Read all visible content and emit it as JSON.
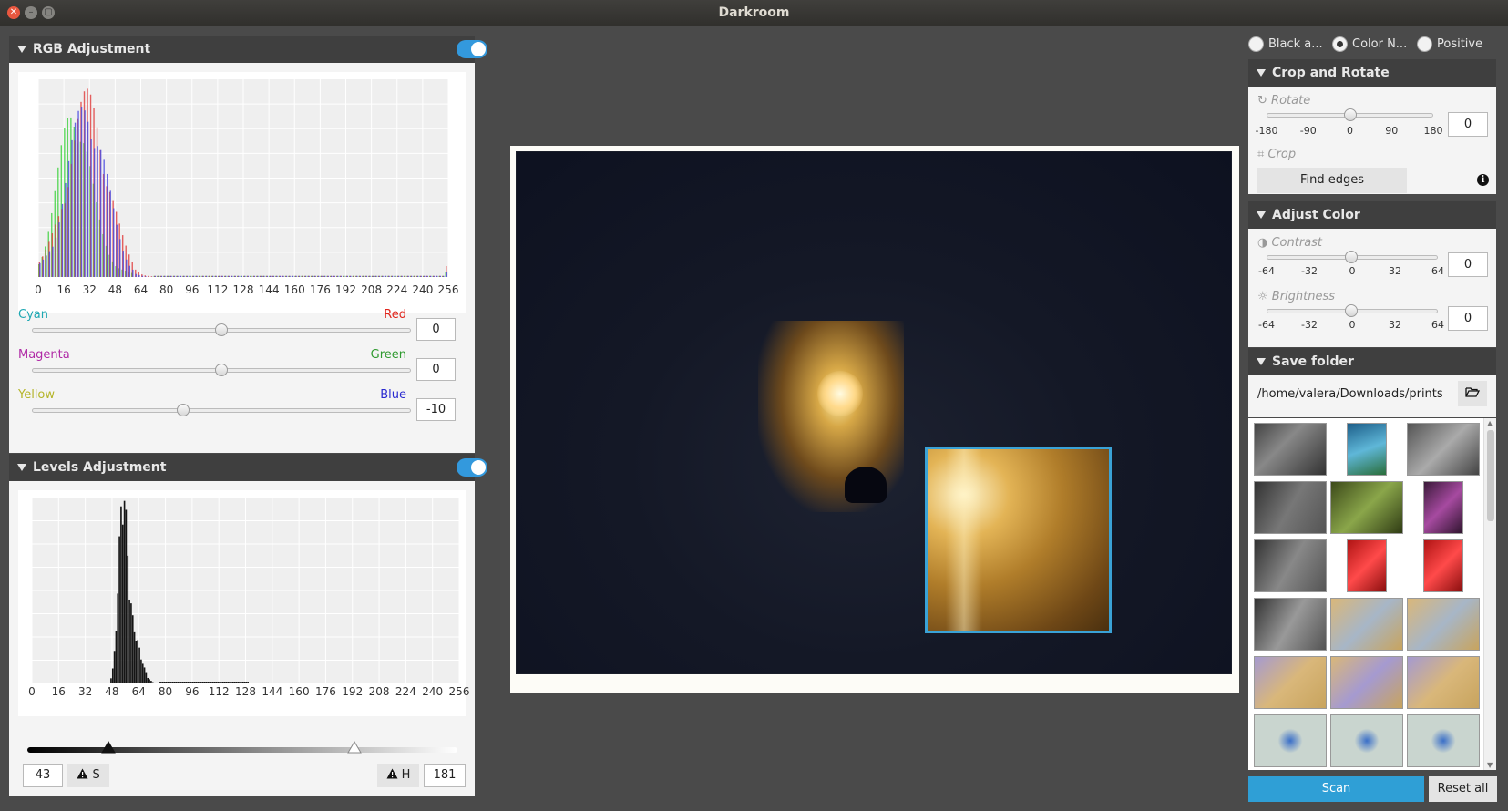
{
  "window": {
    "title": "Darkroom"
  },
  "rgb": {
    "title": "RGB Adjustment",
    "enabled": true,
    "histogram_ticks": [
      "0",
      "16",
      "32",
      "48",
      "64",
      "80",
      "96",
      "112",
      "128",
      "144",
      "160",
      "176",
      "192",
      "208",
      "224",
      "240",
      "256"
    ],
    "channels": [
      {
        "left": "Cyan",
        "right": "Red",
        "value": "0",
        "left_color": "#1fa8b3",
        "right_color": "#e0261d",
        "position": 0.5
      },
      {
        "left": "Magenta",
        "right": "Green",
        "value": "0",
        "left_color": "#b02aa6",
        "right_color": "#2f9a2f",
        "position": 0.5
      },
      {
        "left": "Yellow",
        "right": "Blue",
        "value": "-10",
        "left_color": "#b5b52a",
        "right_color": "#2a2ad0",
        "position": 0.4
      }
    ]
  },
  "levels": {
    "title": "Levels Adjustment",
    "enabled": true,
    "histogram_ticks": [
      "0",
      "16",
      "32",
      "48",
      "64",
      "80",
      "96",
      "112",
      "128",
      "144",
      "160",
      "176",
      "192",
      "208",
      "224",
      "240",
      "256"
    ],
    "shadow_value": "43",
    "highlight_value": "181",
    "shadow_button": "S",
    "highlight_button": "H"
  },
  "right": {
    "modes": [
      {
        "label": "Black a...",
        "selected": false
      },
      {
        "label": "Color N...",
        "selected": true
      },
      {
        "label": "Positive",
        "selected": false
      }
    ],
    "crop_rotate": {
      "title": "Crop and Rotate",
      "rotate_label": "Rotate",
      "rotate_ticks": [
        "-180",
        "-90",
        "0",
        "90",
        "180"
      ],
      "rotate_value": "0",
      "crop_label": "Crop",
      "find_edges": "Find edges"
    },
    "adjust_color": {
      "title": "Adjust Color",
      "contrast_label": "Contrast",
      "contrast_value": "0",
      "brightness_label": "Brightness",
      "brightness_value": "0",
      "ticks": [
        "-64",
        "-32",
        "0",
        "32",
        "64"
      ]
    },
    "save_folder": {
      "title": "Save folder",
      "path": "/home/valera/Downloads/prints"
    },
    "scan_button": "Scan",
    "reset_button": "Reset all"
  },
  "icons": {
    "rotate": "rotate-icon",
    "crop": "crop-icon",
    "contrast": "contrast-icon",
    "brightness": "brightness-icon",
    "info": "info-icon",
    "folder": "folder-open-icon",
    "warning": "warning-icon"
  }
}
